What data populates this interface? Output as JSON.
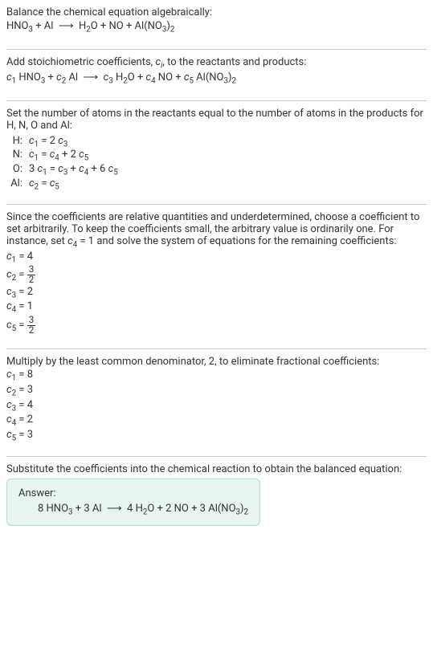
{
  "title": "Balance the chemical equation algebraically:",
  "initial_equation": "HNO₃ + Al ⟶ H₂O + NO + Al(NO₃)₂",
  "step1_text": "Add stoichiometric coefficients, cᵢ, to the reactants and products:",
  "step1_equation": "c₁ HNO₃ + c₂ Al ⟶ c₃ H₂O + c₄ NO + c₅ Al(NO₃)₂",
  "step2_text": "Set the number of atoms in the reactants equal to the number of atoms in the products for H, N, O and Al:",
  "atom_equations": [
    {
      "label": "H:",
      "eq": "c₁ = 2 c₃"
    },
    {
      "label": "N:",
      "eq": "c₁ = c₄ + 2 c₅"
    },
    {
      "label": "O:",
      "eq": "3 c₁ = c₃ + c₄ + 6 c₅"
    },
    {
      "label": "Al:",
      "eq": "c₂ = c₅"
    }
  ],
  "step3_text": "Since the coefficients are relative quantities and underdetermined, choose a coefficient to set arbitrarily. To keep the coefficients small, the arbitrary value is ordinarily one. For instance, set c₄ = 1 and solve the system of equations for the remaining coefficients:",
  "coeffs1": [
    {
      "var": "c₁",
      "val": "4",
      "frac": false
    },
    {
      "var": "c₂",
      "val": "3/2",
      "frac": true,
      "num": "3",
      "den": "2"
    },
    {
      "var": "c₃",
      "val": "2",
      "frac": false
    },
    {
      "var": "c₄",
      "val": "1",
      "frac": false
    },
    {
      "var": "c₅",
      "val": "3/2",
      "frac": true,
      "num": "3",
      "den": "2"
    }
  ],
  "step4_text": "Multiply by the least common denominator, 2, to eliminate fractional coefficients:",
  "coeffs2": [
    {
      "var": "c₁",
      "val": "8"
    },
    {
      "var": "c₂",
      "val": "3"
    },
    {
      "var": "c₃",
      "val": "4"
    },
    {
      "var": "c₄",
      "val": "2"
    },
    {
      "var": "c₅",
      "val": "3"
    }
  ],
  "step5_text": "Substitute the coefficients into the chemical reaction to obtain the balanced equation:",
  "answer_label": "Answer:",
  "answer_equation": "8 HNO₃ + 3 Al ⟶ 4 H₂O + 2 NO + 3 Al(NO₃)₂",
  "chart_data": {
    "type": "table",
    "title": "Chemical equation balancing coefficients",
    "atom_balance": {
      "H": "c1 = 2c3",
      "N": "c1 = c4 + 2c5",
      "O": "3c1 = c3 + c4 + 6c5",
      "Al": "c2 = c5"
    },
    "solution_fractional": {
      "c1": 4,
      "c2": 1.5,
      "c3": 2,
      "c4": 1,
      "c5": 1.5
    },
    "solution_integer": {
      "c1": 8,
      "c2": 3,
      "c3": 4,
      "c4": 2,
      "c5": 3
    },
    "balanced": "8 HNO3 + 3 Al -> 4 H2O + 2 NO + 3 Al(NO3)2"
  }
}
